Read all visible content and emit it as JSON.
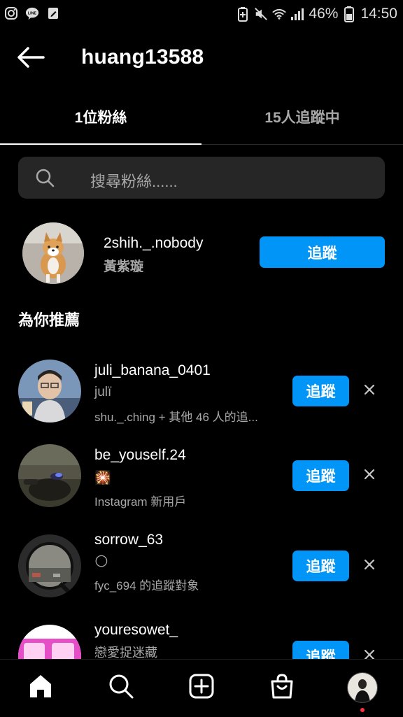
{
  "status_bar": {
    "battery_percent": "46%",
    "time": "14:50",
    "left_icons": [
      "instagram-icon",
      "line-icon",
      "edit-note-icon"
    ],
    "right_icons": [
      "battery-saver-icon",
      "mute-icon",
      "wifi-icon",
      "signal-icon",
      "battery-icon"
    ]
  },
  "header": {
    "title": "huang13588",
    "back_icon": "arrow-left-icon"
  },
  "tabs": [
    {
      "label": "1位粉絲",
      "active": true
    },
    {
      "label": "15人追蹤中",
      "active": false
    }
  ],
  "search": {
    "placeholder": "搜尋粉絲......",
    "icon": "search-icon"
  },
  "followers": [
    {
      "username": "2shih._.nobody",
      "display_name": "黃紫璇",
      "action": "追蹤"
    }
  ],
  "suggestions_title": "為你推薦",
  "suggestions": [
    {
      "username": "juli_banana_0401",
      "display_name": "julï",
      "reason": "shu._.ching + 其他 46 人的追...",
      "action": "追蹤"
    },
    {
      "username": "be_youself.24",
      "display_name": "🎇",
      "reason": "Instagram 新用戶",
      "action": "追蹤"
    },
    {
      "username": "sorrow_63",
      "display_name": "🌕",
      "reason": "fyc_694 的追蹤對象",
      "action": "追蹤"
    },
    {
      "username": "youresowet_",
      "display_name": "戀愛捉迷藏",
      "reason": "",
      "action": "追蹤"
    }
  ],
  "bottom_nav": [
    "home-icon",
    "search-icon",
    "create-post-icon",
    "shop-icon",
    "profile-avatar"
  ],
  "colors": {
    "background": "#000000",
    "accent": "#0095f6",
    "secondary_text": "#a8a8a8",
    "search_bg": "#262626",
    "notification_dot": "#ff3040"
  }
}
